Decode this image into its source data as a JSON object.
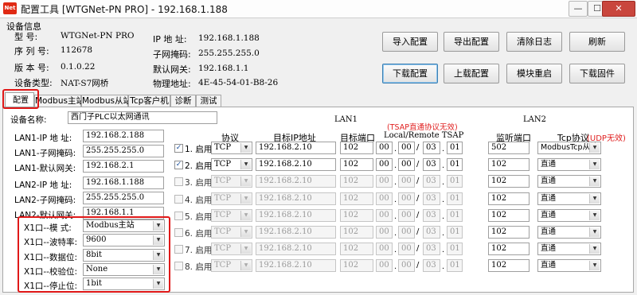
{
  "window": {
    "icon_text": "Net",
    "title": "配置工具 [WTGNet-PN PRO] - 192.168.1.188",
    "minimize": "—",
    "maximize": "☐",
    "close": "✕"
  },
  "device_info": {
    "heading": "设备信息",
    "model_label": "型    号:",
    "model": "WTGNet-PN PRO",
    "serial_label": "序 列 号:",
    "serial": "112678",
    "version_label": "版 本 号:",
    "version": "0.1.0.22",
    "type_label": "设备类型:",
    "type": "NAT-S7网桥",
    "ip_label": "IP 地 址:",
    "ip": "192.168.1.188",
    "mask_label": "子网掩码:",
    "mask": "255.255.255.0",
    "gateway_label": "默认网关:",
    "gateway": "192.168.1.1",
    "mac_label": "物理地址:",
    "mac": "4E-45-54-01-B8-26"
  },
  "buttons": {
    "import": "导入配置",
    "export": "导出配置",
    "clear_log": "清除日志",
    "refresh": "刷新",
    "download_config": "下载配置",
    "upload_config": "上载配置",
    "reboot": "模块重启",
    "download_firmware": "下载固件"
  },
  "tabs": [
    "配置",
    "Modbus主站",
    "Modbus从站",
    "Tcp客户机",
    "诊断",
    "测试"
  ],
  "config": {
    "device_name_label": "设备名称:",
    "device_name": "西门子PLC以太网通讯",
    "lan1_ip_label": "LAN1-IP 地 址:",
    "lan1_ip": "192.168.2.188",
    "lan1_mask_label": "LAN1-子网掩码:",
    "lan1_mask": "255.255.255.0",
    "lan1_gw_label": "LAN1-默认网关:",
    "lan1_gw": "192.168.2.1",
    "lan2_ip_label": "LAN2-IP 地 址:",
    "lan2_ip": "192.168.1.188",
    "lan2_mask_label": "LAN2-子网掩码:",
    "lan2_mask": "255.255.255.0",
    "lan2_gw_label": "LAN2-默认网关:",
    "lan2_gw": "192.168.1.1",
    "x1_mode_label": "X1口--模  式:",
    "x1_mode": "Modbus主站",
    "x1_baud_label": "X1口--波特率:",
    "x1_baud": "9600",
    "x1_data_label": "X1口--数据位:",
    "x1_data": "8bit",
    "x1_parity_label": "X1口--校验位:",
    "x1_parity": "None",
    "x1_stop_label": "X1口--停止位:",
    "x1_stop": "1bit"
  },
  "table": {
    "lan1_header": "LAN1",
    "lan2_header": "LAN2",
    "tsap_note": "(TSAP直通协议无效)",
    "udp_note": "(UDP无效)",
    "col_protocol": "协议",
    "col_target_ip": "目标IP地址",
    "col_target_port": "目标端口",
    "col_tsap": "Local/Remote TSAP",
    "col_listen_port": "监听端口",
    "col_tcp_proto": "Tcp协议",
    "enable_suffix": "启用",
    "rows": [
      {
        "num": "1.",
        "checked": "✓",
        "enabled": true,
        "protocol": "TCP",
        "ip": "192.168.2.10",
        "port": "102",
        "t1": "00",
        "t2": "00",
        "t3": "03",
        "t4": "01",
        "listen": "502",
        "tcp": "ModbusTcp从站"
      },
      {
        "num": "2.",
        "checked": "✓",
        "enabled": true,
        "protocol": "TCP",
        "ip": "192.168.2.10",
        "port": "102",
        "t1": "00",
        "t2": "00",
        "t3": "03",
        "t4": "01",
        "listen": "102",
        "tcp": "直通"
      },
      {
        "num": "3.",
        "checked": "",
        "enabled": false,
        "protocol": "TCP",
        "ip": "192.168.2.10",
        "port": "102",
        "t1": "00",
        "t2": "00",
        "t3": "03",
        "t4": "01",
        "listen": "102",
        "tcp": "直通"
      },
      {
        "num": "4.",
        "checked": "",
        "enabled": false,
        "protocol": "TCP",
        "ip": "192.168.2.10",
        "port": "102",
        "t1": "00",
        "t2": "00",
        "t3": "03",
        "t4": "01",
        "listen": "102",
        "tcp": "直通"
      },
      {
        "num": "5.",
        "checked": "",
        "enabled": false,
        "protocol": "TCP",
        "ip": "192.168.2.10",
        "port": "102",
        "t1": "00",
        "t2": "00",
        "t3": "03",
        "t4": "01",
        "listen": "102",
        "tcp": "直通"
      },
      {
        "num": "6.",
        "checked": "",
        "enabled": false,
        "protocol": "TCP",
        "ip": "192.168.2.10",
        "port": "102",
        "t1": "00",
        "t2": "00",
        "t3": "03",
        "t4": "01",
        "listen": "102",
        "tcp": "直通"
      },
      {
        "num": "7.",
        "checked": "",
        "enabled": false,
        "protocol": "TCP",
        "ip": "192.168.2.10",
        "port": "102",
        "t1": "00",
        "t2": "00",
        "t3": "03",
        "t4": "01",
        "listen": "102",
        "tcp": "直通"
      },
      {
        "num": "8.",
        "checked": "",
        "enabled": false,
        "protocol": "TCP",
        "ip": "192.168.2.10",
        "port": "102",
        "t1": "00",
        "t2": "00",
        "t3": "03",
        "t4": "01",
        "listen": "102",
        "tcp": "直通"
      }
    ]
  },
  "icons": {
    "dropdown": "▼",
    "dot": ".",
    "slash": "/"
  },
  "colors": {
    "highlight_box": "#e01818",
    "note_red": "#e02020",
    "close_button": "#c9463d"
  }
}
